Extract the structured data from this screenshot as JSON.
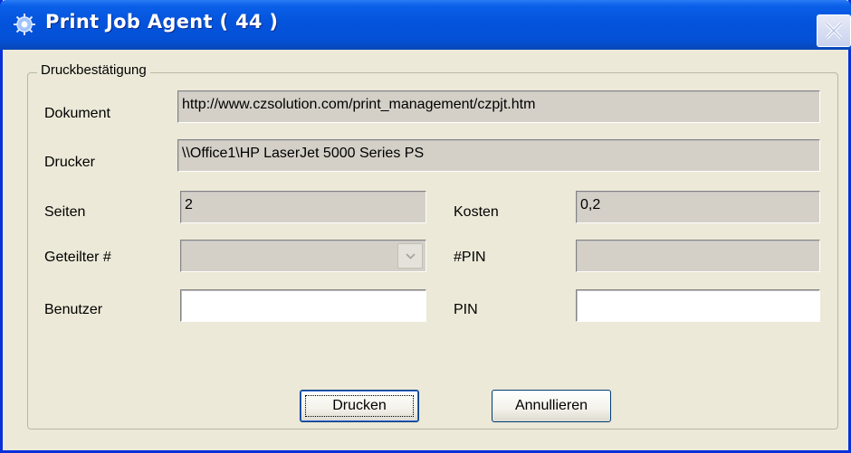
{
  "window": {
    "title": "Print Job Agent ( 44 )"
  },
  "group": {
    "legend": "Druckbestätigung"
  },
  "fields": {
    "dokument": {
      "label": "Dokument",
      "value": "http://www.czsolution.com/print_management/czpjt.htm"
    },
    "drucker": {
      "label": "Drucker",
      "value": "\\\\Office1\\HP LaserJet 5000 Series PS"
    },
    "seiten": {
      "label": "Seiten",
      "value": "2"
    },
    "kosten": {
      "label": "Kosten",
      "value": "0,2"
    },
    "geteilter": {
      "label": "Geteilter #",
      "value": ""
    },
    "pin_hash": {
      "label": "#PIN",
      "value": ""
    },
    "benutzer": {
      "label": "Benutzer",
      "value": ""
    },
    "pin": {
      "label": "PIN",
      "value": ""
    }
  },
  "buttons": {
    "print": "Drucken",
    "cancel": "Annullieren"
  },
  "colors": {
    "titlebar": "#0453dc",
    "dialog_bg": "#ece9d8",
    "disabled_field": "#d4d0c8"
  }
}
